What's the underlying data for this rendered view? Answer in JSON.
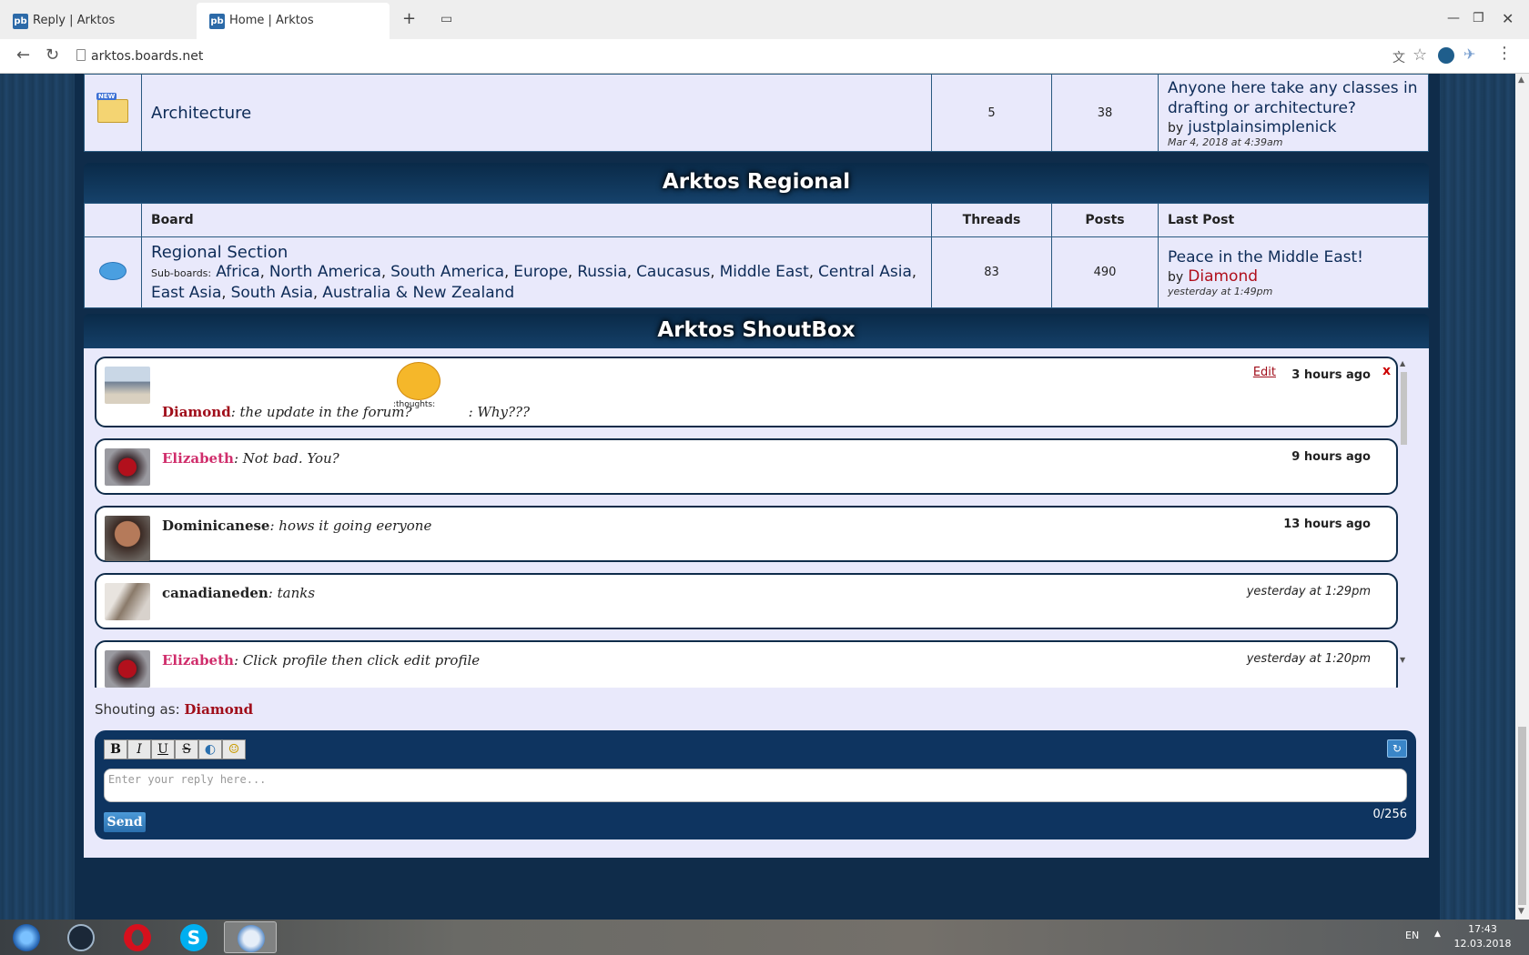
{
  "browser": {
    "tabs": [
      {
        "label": "Reply | Arktos",
        "favicon": "pb"
      },
      {
        "label": "Home | Arktos",
        "favicon": "pb"
      }
    ],
    "url": "arktos.boards.net"
  },
  "architecture_row": {
    "board": "Architecture",
    "threads": "5",
    "posts": "38",
    "last_post_title": "Anyone here take any classes in drafting or architecture?",
    "last_post_by": "by",
    "last_post_user": "justplainsimplenick",
    "last_post_time": "Mar 4, 2018 at 4:39am"
  },
  "regional": {
    "title": "Arktos Regional",
    "headers": {
      "board": "Board",
      "threads": "Threads",
      "posts": "Posts",
      "last_post": "Last Post"
    },
    "row": {
      "board": "Regional Section",
      "subboards_label": "Sub-boards:",
      "subboards_line1": [
        "Africa",
        "North America",
        "South America",
        "Europe",
        "Russia",
        "Caucasus",
        "Middle East",
        "Central Asia",
        "East"
      ],
      "subboards_line2": [
        "Asia",
        "South Asia",
        "Australia & New Zealand"
      ],
      "threads": "83",
      "posts": "490",
      "last_post_title": "Peace in the Middle East!",
      "last_post_by": "by",
      "last_post_user": "Diamond",
      "last_post_time": "yesterday at 1:49pm"
    }
  },
  "shoutbox": {
    "title": "Arktos ShoutBox",
    "shouts": [
      {
        "user": "Diamond",
        "text_before": ": the update in the forum?",
        "emoji_label": ":thoughts:",
        "text_after": ": Why???",
        "time": "3 hours ago",
        "edit_label": "Edit",
        "delete_label": "x"
      },
      {
        "user": "Elizabeth",
        "text": ": Not bad. You?",
        "time": "9 hours ago"
      },
      {
        "user": "Dominicanese",
        "text": ": hows it going eeryone",
        "time": "13 hours ago"
      },
      {
        "user": "canadianeden",
        "text": ": tanks",
        "time": "yesterday at 1:29pm"
      },
      {
        "user": "Elizabeth",
        "text": ": Click profile then click edit profile",
        "time": "yesterday at 1:20pm"
      }
    ],
    "shouting_as_label": "Shouting as:",
    "shouting_as_user": "Diamond",
    "format_buttons": [
      "B",
      "I",
      "U",
      "S"
    ],
    "reply_placeholder": "Enter your reply here...",
    "send_label": "Send",
    "char_counter": "0/256"
  },
  "taskbar": {
    "language": "EN",
    "time": "17:43",
    "date": "12.03.2018"
  },
  "colors": {
    "accent_dark": "#0f2c4a",
    "table_bg": "#e9e9fb",
    "link": "#0d2b57",
    "user_red": "#a00d1a",
    "user_pink": "#d02e6c"
  }
}
